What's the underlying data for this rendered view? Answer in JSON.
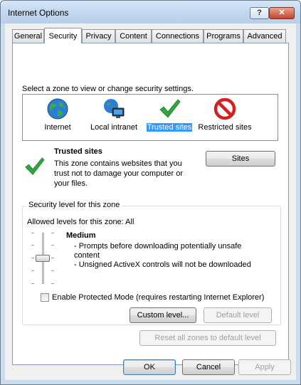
{
  "window": {
    "title": "Internet Options"
  },
  "titlebar": {
    "help_label": "?",
    "close_label": "✕"
  },
  "tabs": [
    {
      "label": "General"
    },
    {
      "label": "Security",
      "active": true
    },
    {
      "label": "Privacy"
    },
    {
      "label": "Content"
    },
    {
      "label": "Connections"
    },
    {
      "label": "Programs"
    },
    {
      "label": "Advanced"
    }
  ],
  "security": {
    "zone_prompt": "Select a zone to view or change security settings.",
    "zones": [
      {
        "label": "Internet",
        "icon": "globe-icon"
      },
      {
        "label": "Local intranet",
        "icon": "intranet-globe-monitor-icon"
      },
      {
        "label": "Trusted sites",
        "icon": "green-checkmark-icon",
        "selected": true
      },
      {
        "label": "Restricted sites",
        "icon": "red-no-entry-icon"
      }
    ],
    "selected_zone": {
      "title": "Trusted sites",
      "description": "This zone contains websites that you trust not to damage your computer or your files.",
      "icon": "green-checkmark-icon"
    },
    "sites_button": "Sites",
    "level_group_label": "Security level for this zone",
    "allowed_levels": "Allowed levels for this zone: All",
    "level": {
      "name": "Medium",
      "bullets": [
        "- Prompts before downloading potentially unsafe content",
        "- Unsigned ActiveX controls will not be downloaded"
      ],
      "slider_position": 0.5
    },
    "protected_mode": {
      "label": "Enable Protected Mode (requires restarting Internet Explorer)",
      "checked": false
    },
    "custom_level_button": "Custom level...",
    "default_level_button": "Default level",
    "reset_all_button": "Reset all zones to default level"
  },
  "footer": {
    "ok": "OK",
    "cancel": "Cancel",
    "apply": "Apply"
  },
  "colors": {
    "selection": "#3399ff",
    "check_green": "#2fa640",
    "restricted_red": "#d42020"
  }
}
